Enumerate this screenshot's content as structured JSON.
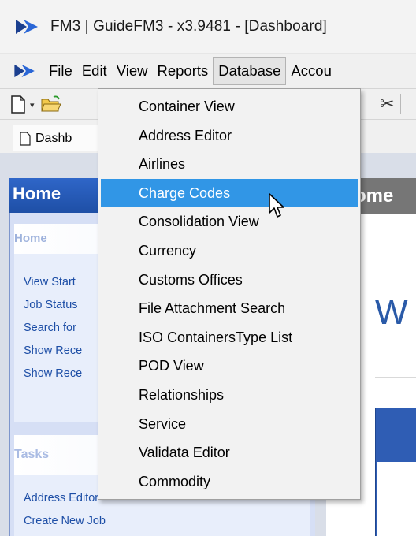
{
  "window": {
    "title": "FM3 | GuideFM3 - x3.9481 - [Dashboard]",
    "logo_icon": "fm3-logo-icon"
  },
  "menubar": {
    "items": [
      {
        "label": "File"
      },
      {
        "label": "Edit"
      },
      {
        "label": "View"
      },
      {
        "label": "Reports"
      },
      {
        "label": "Database",
        "active": true
      },
      {
        "label": "Accou"
      }
    ]
  },
  "toolbar": {
    "icons": [
      "new-document-icon",
      "dropdown-arrow-icon",
      "open-folder-icon",
      "cut-icon"
    ],
    "dropdown_glyph": "▾",
    "cut_glyph": "✂"
  },
  "tabs": [
    {
      "label": "Dashb",
      "icon": "page-icon"
    }
  ],
  "sidebar": {
    "title": "Home",
    "home_panel": {
      "heading": "Home",
      "links": [
        "View Start",
        "Job Status",
        "Search for",
        "Show Rece",
        "Show Rece"
      ]
    },
    "tasks_panel": {
      "heading": "Tasks",
      "links": [
        "Address Editor",
        "Create New Job"
      ]
    }
  },
  "main": {
    "header": "ome",
    "welcome": "W"
  },
  "dropdown": {
    "items": [
      {
        "label": "Container View"
      },
      {
        "label": "Address Editor"
      },
      {
        "label": "Airlines"
      },
      {
        "label": "Charge Codes",
        "highlighted": true
      },
      {
        "label": "Consolidation View"
      },
      {
        "label": "Currency"
      },
      {
        "label": "Customs Offices"
      },
      {
        "label": "File Attachment Search"
      },
      {
        "label": "ISO ContainersType List"
      },
      {
        "label": "POD View"
      },
      {
        "label": "Relationships"
      },
      {
        "label": "Service"
      },
      {
        "label": "Validata Editor"
      },
      {
        "label": "Commodity"
      }
    ]
  },
  "colors": {
    "highlight": "#3196e6",
    "sidebar_header": "#1e4fa6",
    "link": "#1d4ea6",
    "main_header": "#767676"
  }
}
